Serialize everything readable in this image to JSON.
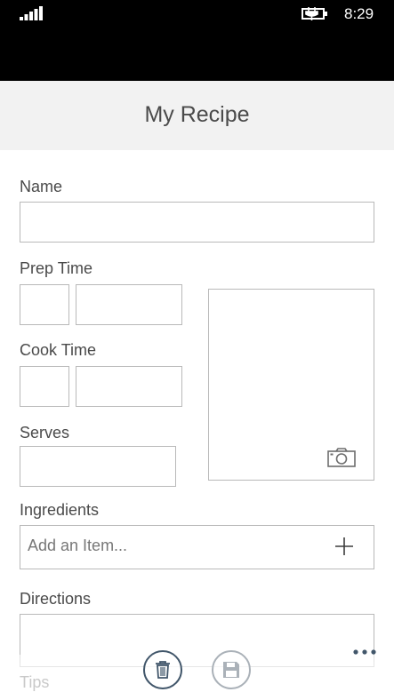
{
  "status": {
    "time": "8:29",
    "signal_icon": "signal-bars-icon",
    "battery_icon": "battery-charging-icon"
  },
  "header": {
    "title": "My Recipe"
  },
  "form": {
    "name_label": "Name",
    "prep_time_label": "Prep Time",
    "cook_time_label": "Cook Time",
    "serves_label": "Serves",
    "ingredients_label": "Ingredients",
    "add_item_placeholder": "Add an Item...",
    "directions_label": "Directions",
    "tips_label": "Tips",
    "photo_icon": "camera-icon"
  },
  "app_bar": {
    "buttons": [
      {
        "icon": "trash-icon",
        "enabled": true
      },
      {
        "icon": "save-icon",
        "enabled": false
      }
    ],
    "more_icon": "more-dots-icon"
  },
  "colors": {
    "accent": "#41566a",
    "header_bg": "#f2f2f2",
    "border": "#b9b9b9"
  }
}
